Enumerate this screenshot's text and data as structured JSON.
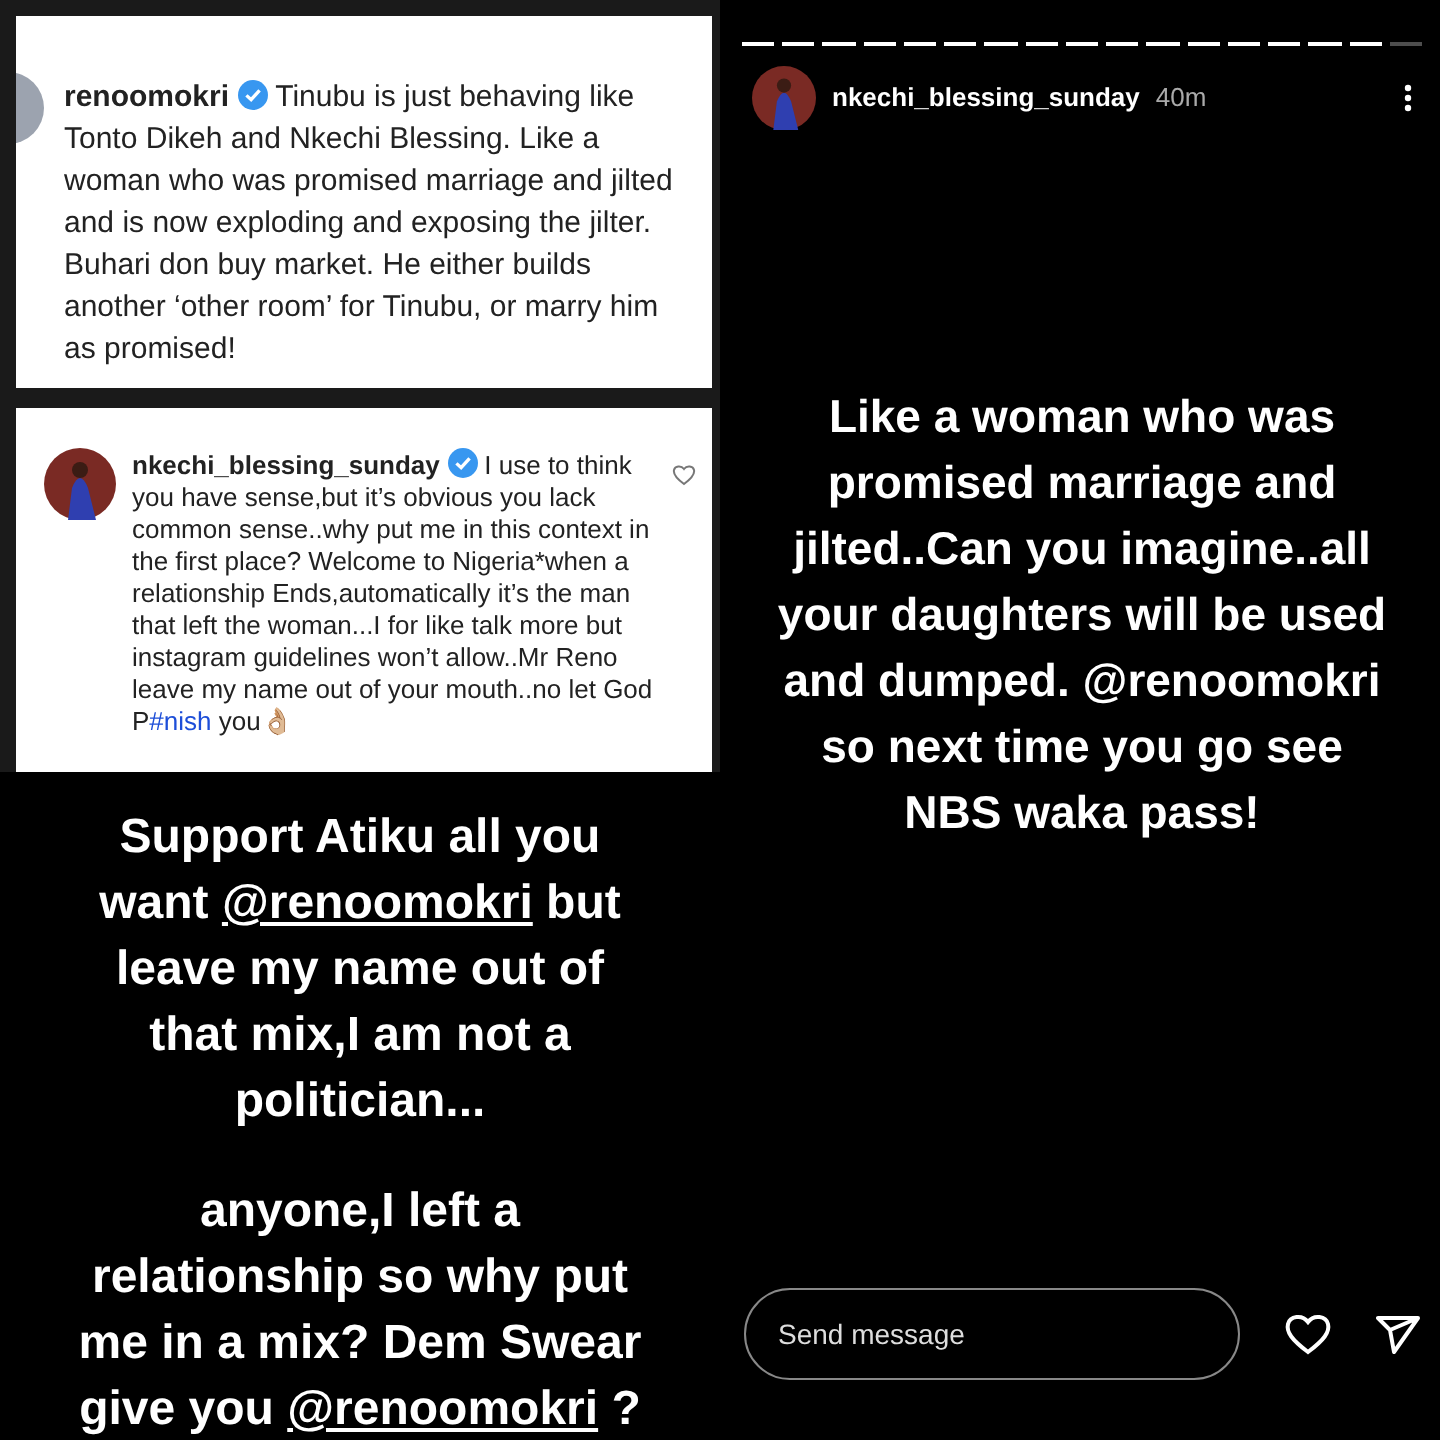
{
  "comment_post": {
    "username": "renoomokri",
    "verified": true,
    "text": "Tinubu is just behaving like Tonto Dikeh and Nkechi Blessing. Like a woman who was promised marriage and jilted and is now exploding and exposing the jilter. Buhari don buy market. He either builds another ‘other room’ for Tinubu, or marry him as promised!"
  },
  "reply_comment": {
    "username": "nkechi_blessing_sunday",
    "verified": true,
    "liked": false,
    "segments": [
      {
        "kind": "plain",
        "text": "I use to think you have sense,but it’s obvious you lack common sense..why put me in this context in the first place? Welcome to Nigeria*when a relationship Ends,automatically it’s the man that left the woman...I for like talk more but instagram guidelines won’t allow..Mr Reno leave my name out of your mouth..no let God P"
      },
      {
        "kind": "hashtag",
        "text": "#nish"
      },
      {
        "kind": "plain",
        "text": " you👌🏼"
      }
    ]
  },
  "left_story": {
    "paragraphs": [
      [
        {
          "kind": "plain",
          "text": "Support Atiku all you want "
        },
        {
          "kind": "mention",
          "text": "@renoomokri"
        },
        {
          "kind": "plain",
          "text": " but leave my name out of that mix,I am not a politician..."
        }
      ],
      [
        {
          "kind": "plain",
          "text": "anyone,I left a relationship so why put me in a mix? Dem Swear give you "
        },
        {
          "kind": "mention",
          "text": "@renoomokri"
        },
        {
          "kind": "plain",
          "text": " ?"
        }
      ]
    ]
  },
  "right_story": {
    "progress": [
      {
        "level": 1
      },
      {
        "level": 1
      },
      {
        "level": 1
      },
      {
        "level": 1
      },
      {
        "level": 1
      },
      {
        "level": 1
      },
      {
        "level": 1
      },
      {
        "level": 1
      },
      {
        "level": 1
      },
      {
        "level": 1
      },
      {
        "level": 1
      },
      {
        "level": 1
      },
      {
        "level": 1
      },
      {
        "level": 1
      },
      {
        "level": 1
      },
      {
        "level": 1
      },
      {
        "level": 0
      }
    ],
    "username": "nkechi_blessing_sunday",
    "time": "40m",
    "text": "Like a woman who was promised marriage and jilted..Can you imagine..all your daughters will be used and dumped. @renoomokri so next time you go see NBS waka pass!",
    "message_placeholder": "Send message"
  }
}
